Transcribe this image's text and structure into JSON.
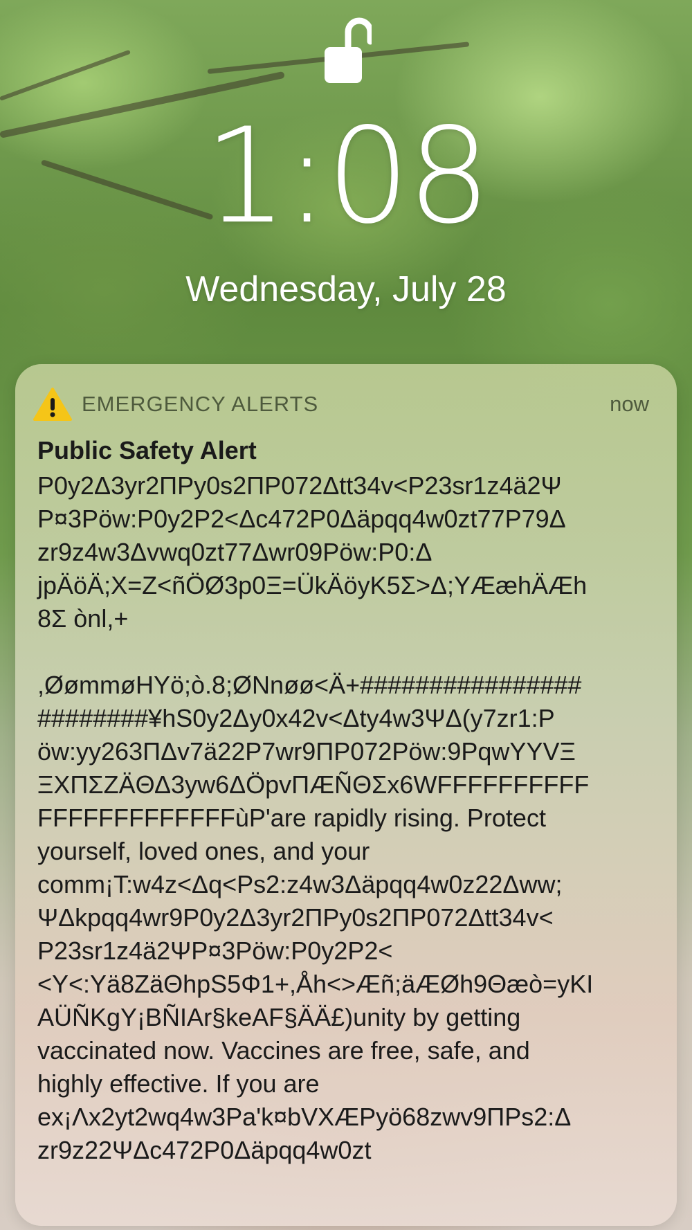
{
  "lockscreen": {
    "time": "1:08",
    "date": "Wednesday, July 28"
  },
  "notification": {
    "app_name": "EMERGENCY ALERTS",
    "time_ago": "now",
    "title": "Public Safety Alert",
    "body_lines": [
      "P0y2Δ3yr2ΠPy0s2ΠP072Δtt34v<P23sr1z4ä2Ψ",
      "P¤3Pöw:P0y2P2<Δc472P0Δäpqq4w0zt77P79Δ",
      "zr9z4w3Δvwq0zt77Δwr09Pöw:P0:Δ",
      "jpÄöÄ;X=Z<ñÖØ3p0Ξ=ÜkÄöyK5Σ>Δ;YÆæhÄÆh",
      "8Σ ònl,+",
      "",
      ",ØømmøHYö;ò.8;ØNnøø<Ä+################",
      "########¥hS0y2Δy0x42v<Δty4w3ΨΔ(y7zr1:P",
      "öw:yy263ΠΔv7ä22P7wr9ΠP072Pöw:9PqwYYVΞ",
      "ΞXΠΣZÄΘΔ3yw6ΔÖpvΠÆÑΘΣx6WFFFFFFFFFF",
      "FFFFFFFFFFFFFùP'are rapidly rising. Protect",
      "yourself, loved ones, and your",
      "comm¡T:w4z<Δq<Ps2:z4w3Δäpqq4w0z22Δww;",
      "ΨΔkpqq4wr9P0y2Δ3yr2ΠPy0s2ΠP072Δtt34v<",
      "P23sr1z4ä2ΨP¤3Pöw:P0y2P2<",
      "<Y<:Yä8ZäΘhpS5Φ1+,Åh<>Æñ;äÆØh9Θæò=yKI",
      "AÜÑKgY¡BÑIAr§keAF§ÄÄ£)unity by getting",
      "vaccinated now. Vaccines are free, safe, and",
      "highly effective. If you are",
      "ex¡Λx2yt2wq4w3Pa'k¤bVXÆPyö68zwv9ΠPs2:Δ",
      "zr9z22ΨΔc472P0Δäpqq4w0zt"
    ]
  },
  "icons": {
    "lock": "unlocked-padlock-icon",
    "warning": "warning-triangle-icon"
  },
  "colors": {
    "warning_yellow": "#f5c518",
    "header_text": "#4e5a3d",
    "body_text": "#1a1a1a"
  }
}
